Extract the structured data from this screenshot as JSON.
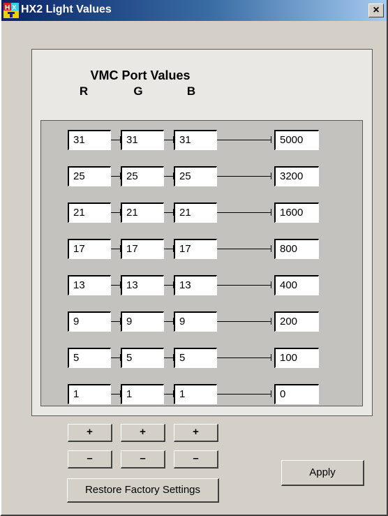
{
  "window": {
    "title": "HX2 Light Values",
    "close_label": "×"
  },
  "header": {
    "title": "VMC Port Values",
    "col_r": "R",
    "col_g": "G",
    "col_b": "B"
  },
  "rows": [
    {
      "r": "31",
      "g": "31",
      "b": "31",
      "value": "5000"
    },
    {
      "r": "25",
      "g": "25",
      "b": "25",
      "value": "3200"
    },
    {
      "r": "21",
      "g": "21",
      "b": "21",
      "value": "1600"
    },
    {
      "r": "17",
      "g": "17",
      "b": "17",
      "value": "800"
    },
    {
      "r": "13",
      "g": "13",
      "b": "13",
      "value": "400"
    },
    {
      "r": "9",
      "g": "9",
      "b": "9",
      "value": "200"
    },
    {
      "r": "5",
      "g": "5",
      "b": "5",
      "value": "100"
    },
    {
      "r": "1",
      "g": "1",
      "b": "1",
      "value": "0"
    }
  ],
  "buttons": {
    "plus_r": "+",
    "plus_g": "+",
    "plus_b": "+",
    "minus_r": "–",
    "minus_g": "–",
    "minus_b": "–",
    "restore": "Restore Factory Settings",
    "apply": "Apply"
  }
}
